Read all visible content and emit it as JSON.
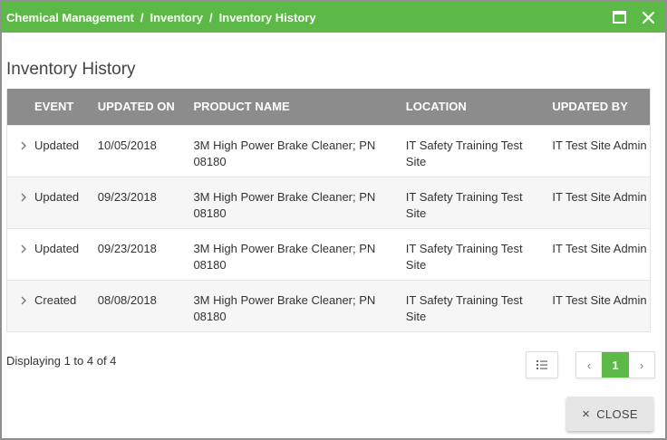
{
  "breadcrumb": {
    "items": [
      "Chemical Management",
      "Inventory",
      "Inventory History"
    ],
    "separator": "/"
  },
  "window_controls": {
    "maximize": "maximize-icon",
    "close": "close-icon"
  },
  "page_title": "Inventory History",
  "table": {
    "columns": [
      "EVENT",
      "UPDATED ON",
      "PRODUCT NAME",
      "LOCATION",
      "UPDATED BY"
    ],
    "rows": [
      {
        "event": "Updated",
        "updated_on": "10/05/2018",
        "product": "3M High Power Brake Cleaner; PN 08180",
        "location": "IT Safety Training Test Site",
        "updated_by": "IT Test Site Admin"
      },
      {
        "event": "Updated",
        "updated_on": "09/23/2018",
        "product": "3M High Power Brake Cleaner; PN 08180",
        "location": "IT Safety Training Test Site",
        "updated_by": "IT Test Site Admin"
      },
      {
        "event": "Updated",
        "updated_on": "09/23/2018",
        "product": "3M High Power Brake Cleaner; PN 08180",
        "location": "IT Safety Training Test Site",
        "updated_by": "IT Test Site Admin"
      },
      {
        "event": "Created",
        "updated_on": "08/08/2018",
        "product": "3M High Power Brake Cleaner; PN 08180",
        "location": "IT Safety Training Test Site",
        "updated_by": "IT Test Site Admin"
      }
    ]
  },
  "footer": {
    "displaying": "Displaying 1 to 4 of 4",
    "pagination": {
      "prev": "‹",
      "current": "1",
      "next": "›"
    },
    "close_label": "CLOSE",
    "close_icon": "×"
  },
  "colors": {
    "accent": "#5cb947",
    "header_bg": "#8c8c8c"
  }
}
